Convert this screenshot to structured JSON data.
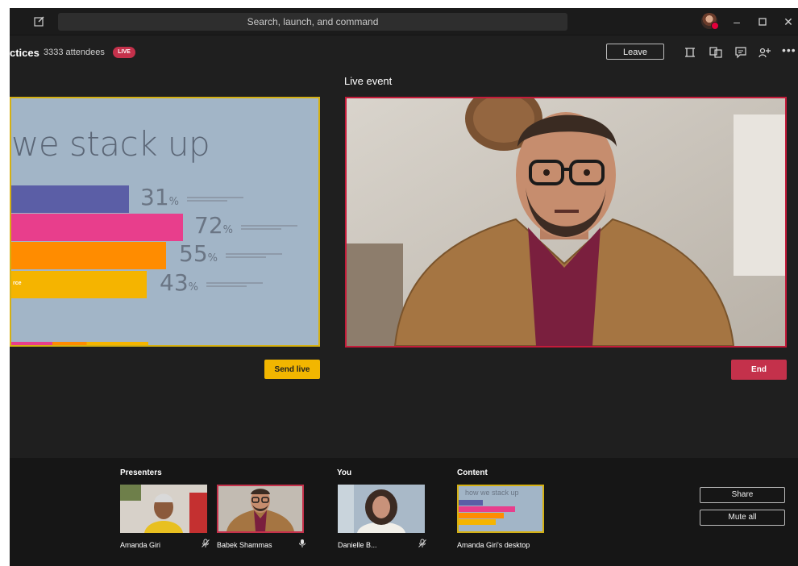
{
  "titlebar": {
    "search_placeholder": "Search, launch, and command"
  },
  "header": {
    "title_fragment": "ctices",
    "attendees": "3333 attendees",
    "live_badge": "LIVE",
    "leave_label": "Leave"
  },
  "queue": {
    "slide_title": "we stack up",
    "bars": [
      {
        "pct": "31",
        "color": "#5b5ea6",
        "value": 31
      },
      {
        "pct": "72",
        "color": "#e83e8c",
        "value": 72
      },
      {
        "pct": "55",
        "color": "#ff8c00",
        "value": 55
      },
      {
        "pct": "43",
        "color": "#f5b400",
        "value": 43,
        "label": "rce"
      }
    ],
    "percent_sign": "%",
    "send_live_label": "Send live"
  },
  "live": {
    "label": "Live event",
    "end_label": "End"
  },
  "tray": {
    "presenters_title": "Presenters",
    "you_title": "You",
    "content_title": "Content",
    "presenters": [
      {
        "name": "Amanda Giri",
        "mic": "mic-off-icon"
      },
      {
        "name": "Babek Shammas",
        "mic": "mic-icon"
      }
    ],
    "you": {
      "name": "Danielle B...",
      "mic": "mic-off-icon"
    },
    "content": {
      "name": "Amanda Giri's desktop",
      "preview_title": "how we stack up"
    },
    "share_label": "Share",
    "mute_all_label": "Mute all"
  },
  "colors": {
    "accent_yellow": "#f2b600",
    "live_red": "#c4314b"
  }
}
